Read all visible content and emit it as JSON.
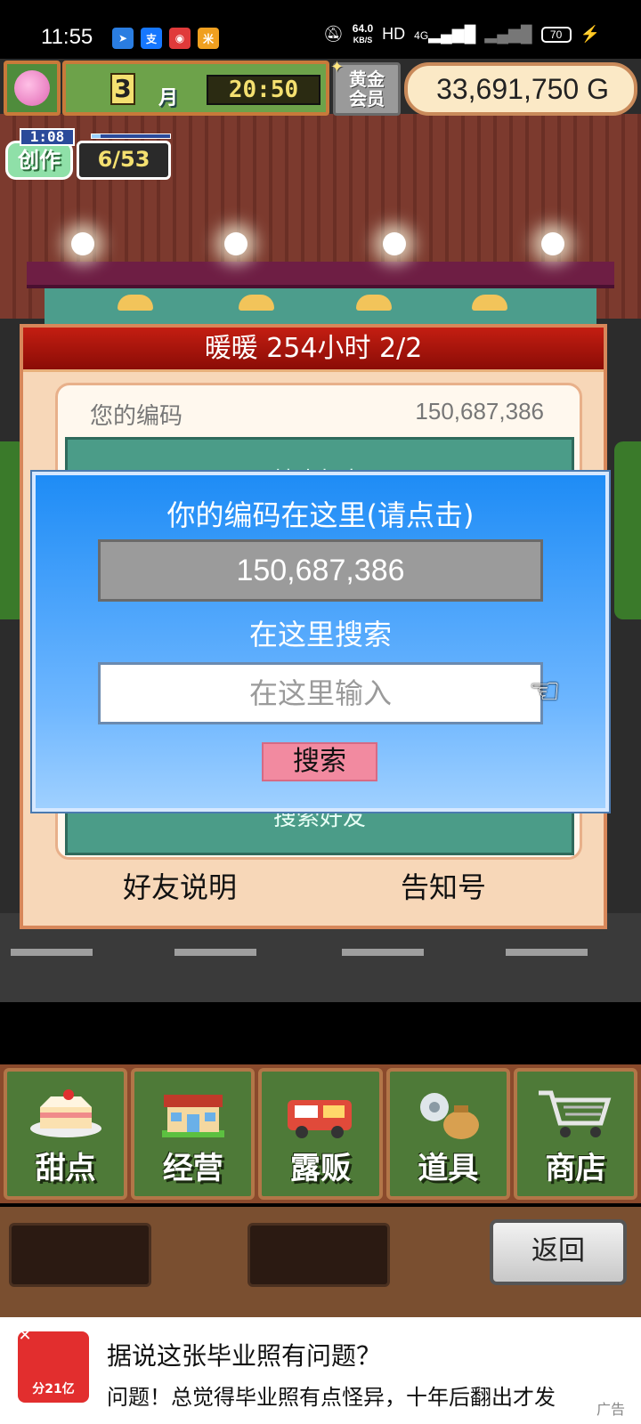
{
  "status_bar": {
    "time": "11:55",
    "apps": [
      {
        "icon": "send-icon",
        "glyph": "➤",
        "color": "#2a7de1"
      },
      {
        "icon": "alipay-icon",
        "glyph": "支",
        "color": "#1677ff"
      },
      {
        "icon": "chat-icon",
        "glyph": "◉",
        "color": "#e03a3a"
      },
      {
        "icon": "app-icon",
        "glyph": "米",
        "color": "#f0a020"
      }
    ],
    "net_speed": "64.0",
    "net_speed_unit": "KB/S",
    "hd": "HD",
    "signal": "4G",
    "battery": "70"
  },
  "hud": {
    "month": "3",
    "month_unit": "月",
    "clock": "20:50",
    "vip_line1": "黄金",
    "vip_line2": "会员",
    "money": "33,691,750 G"
  },
  "craft": {
    "timer": "1:08",
    "label": "创作",
    "count": "6/53",
    "progress": 0.11
  },
  "panel": {
    "title": "暖暖  254小时 2/2",
    "code_label": "您的编码",
    "code_value": "150,687,386",
    "search_friend_label": "搜索好友",
    "friend_info": "好友说明",
    "notice": "告知号"
  },
  "dialog": {
    "code_heading": "你的编码在这里(请点击)",
    "code_value": "150,687,386",
    "search_heading": "在这里搜索",
    "input_placeholder": "在这里输入",
    "search_button": "搜索"
  },
  "menu": [
    {
      "label": "甜点",
      "icon": "cake-icon"
    },
    {
      "label": "经营",
      "icon": "shop-icon"
    },
    {
      "label": "露贩",
      "icon": "food-truck-icon"
    },
    {
      "label": "道具",
      "icon": "items-icon"
    },
    {
      "label": "商店",
      "icon": "cart-icon"
    }
  ],
  "back_button": "返回",
  "ad": {
    "logo_text": "分21亿",
    "title": "据说这张毕业照有问题？",
    "subtitle": "问题！总觉得毕业照有点怪异，十年后翻出才发",
    "tag": "广告"
  }
}
